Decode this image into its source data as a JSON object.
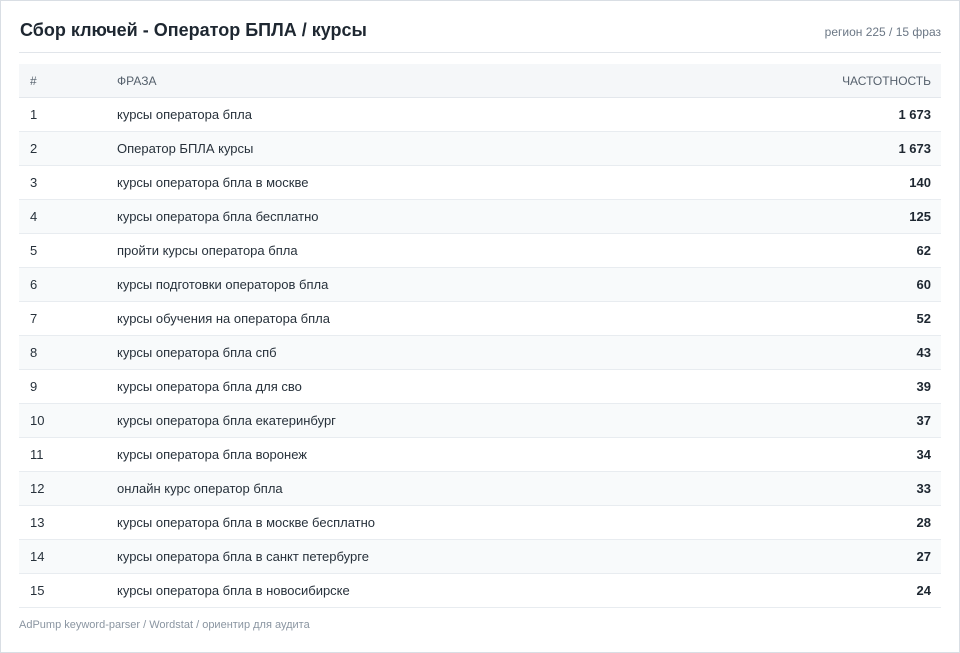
{
  "header": {
    "title": "Сбор ключей - Оператор БПЛА / курсы",
    "meta": "регион 225 / 15 фраз"
  },
  "table": {
    "columns": {
      "num": "#",
      "phrase": "ФРАЗА",
      "freq": "ЧАСТОТНОСТЬ"
    },
    "rows": [
      {
        "num": "1",
        "phrase": "курсы оператора бпла",
        "freq": "1 673"
      },
      {
        "num": "2",
        "phrase": "Оператор БПЛА курсы",
        "freq": "1 673"
      },
      {
        "num": "3",
        "phrase": "курсы оператора бпла в москве",
        "freq": "140"
      },
      {
        "num": "4",
        "phrase": "курсы оператора бпла бесплатно",
        "freq": "125"
      },
      {
        "num": "5",
        "phrase": "пройти курсы оператора бпла",
        "freq": "62"
      },
      {
        "num": "6",
        "phrase": "курсы подготовки операторов бпла",
        "freq": "60"
      },
      {
        "num": "7",
        "phrase": "курсы обучения на оператора бпла",
        "freq": "52"
      },
      {
        "num": "8",
        "phrase": "курсы оператора бпла спб",
        "freq": "43"
      },
      {
        "num": "9",
        "phrase": "курсы оператора бпла для сво",
        "freq": "39"
      },
      {
        "num": "10",
        "phrase": "курсы оператора бпла екатеринбург",
        "freq": "37"
      },
      {
        "num": "11",
        "phrase": "курсы оператора бпла воронеж",
        "freq": "34"
      },
      {
        "num": "12",
        "phrase": "онлайн курс оператор бпла",
        "freq": "33"
      },
      {
        "num": "13",
        "phrase": "курсы оператора бпла в москве бесплатно",
        "freq": "28"
      },
      {
        "num": "14",
        "phrase": "курсы оператора бпла в санкт петербурге",
        "freq": "27"
      },
      {
        "num": "15",
        "phrase": "курсы оператора бпла в новосибирске",
        "freq": "24"
      }
    ]
  },
  "footer": {
    "text": "AdPump keyword-parser / Wordstat / ориентир для аудита"
  }
}
